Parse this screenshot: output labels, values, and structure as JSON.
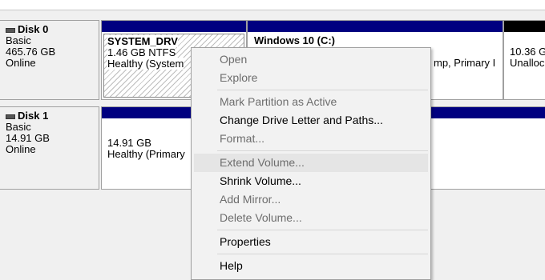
{
  "disks": [
    {
      "name": "Disk 0",
      "type": "Basic",
      "size": "465.76 GB",
      "status": "Online",
      "partitions": [
        {
          "title": "SYSTEM_DRV",
          "line1": "1.46 GB NTFS",
          "line2": "Healthy (System"
        },
        {
          "title": "Windows 10  (C:)",
          "line1": "",
          "line2": "mp, Primary I"
        },
        {
          "title": "",
          "line1": "10.36 G",
          "line2": "Unalloc"
        }
      ]
    },
    {
      "name": "Disk 1",
      "type": "Basic",
      "size": "14.91 GB",
      "status": "Online",
      "partitions": [
        {
          "title": "",
          "line1": "14.91 GB",
          "line2": "Healthy (Primary"
        }
      ]
    }
  ],
  "context_menu": {
    "items": [
      {
        "label": "Open",
        "enabled": false
      },
      {
        "label": "Explore",
        "enabled": false
      },
      {
        "label": "Mark Partition as Active",
        "enabled": false
      },
      {
        "label": "Change Drive Letter and Paths...",
        "enabled": true
      },
      {
        "label": "Format...",
        "enabled": false
      },
      {
        "label": "Extend Volume...",
        "enabled": false,
        "highlighted": true
      },
      {
        "label": "Shrink Volume...",
        "enabled": true
      },
      {
        "label": "Add Mirror...",
        "enabled": false
      },
      {
        "label": "Delete Volume...",
        "enabled": false
      },
      {
        "label": "Properties",
        "enabled": true
      },
      {
        "label": "Help",
        "enabled": true
      }
    ]
  },
  "colors": {
    "primary_bar": "#000080",
    "unallocated_bar": "#000000"
  }
}
